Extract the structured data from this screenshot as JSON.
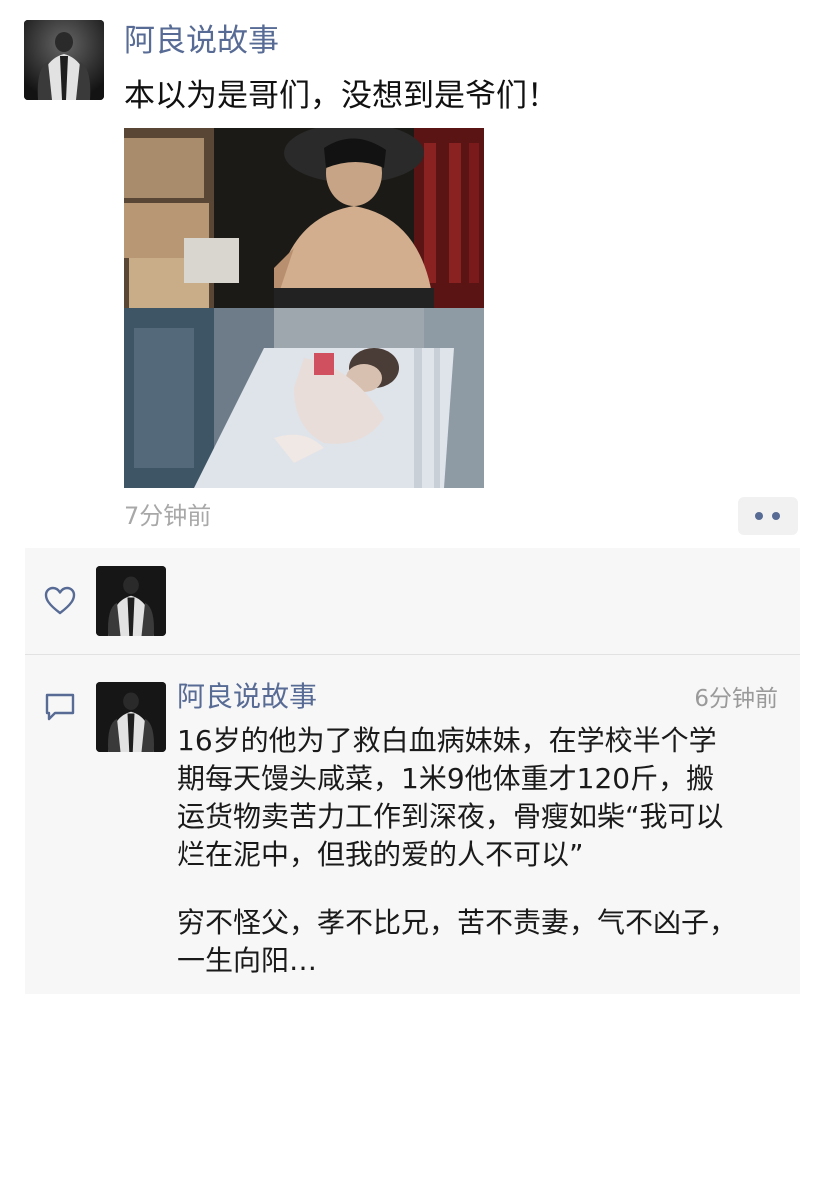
{
  "post": {
    "author": "阿良说故事",
    "text": "本以为是哥们，没想到是爷们！",
    "timestamp": "7分钟前",
    "avatar_icon": "person-avatar",
    "more_icon": "more-dots-icon"
  },
  "likes": {
    "icon": "heart-icon",
    "avatar_icon": "person-avatar"
  },
  "comment": {
    "icon": "comment-bubble-icon",
    "author": "阿良说故事",
    "timestamp": "6分钟前",
    "lines": [
      "16岁的他为了救白血病妹妹，在学校半个学",
      "期每天馒头咸菜，1米9他体重才120斤，搬",
      "运货物卖苦力工作到深夜，骨瘦如柴“我可以",
      "烂在泥中，但我的爱的人不可以”",
      "穷不怪父，孝不比兄，苦不责妻，气不凶子，",
      "一生向阳…"
    ]
  },
  "colors": {
    "name_link": "#576b95",
    "panel_bg": "#f7f7f7",
    "time_gray": "#a8a8a8"
  }
}
